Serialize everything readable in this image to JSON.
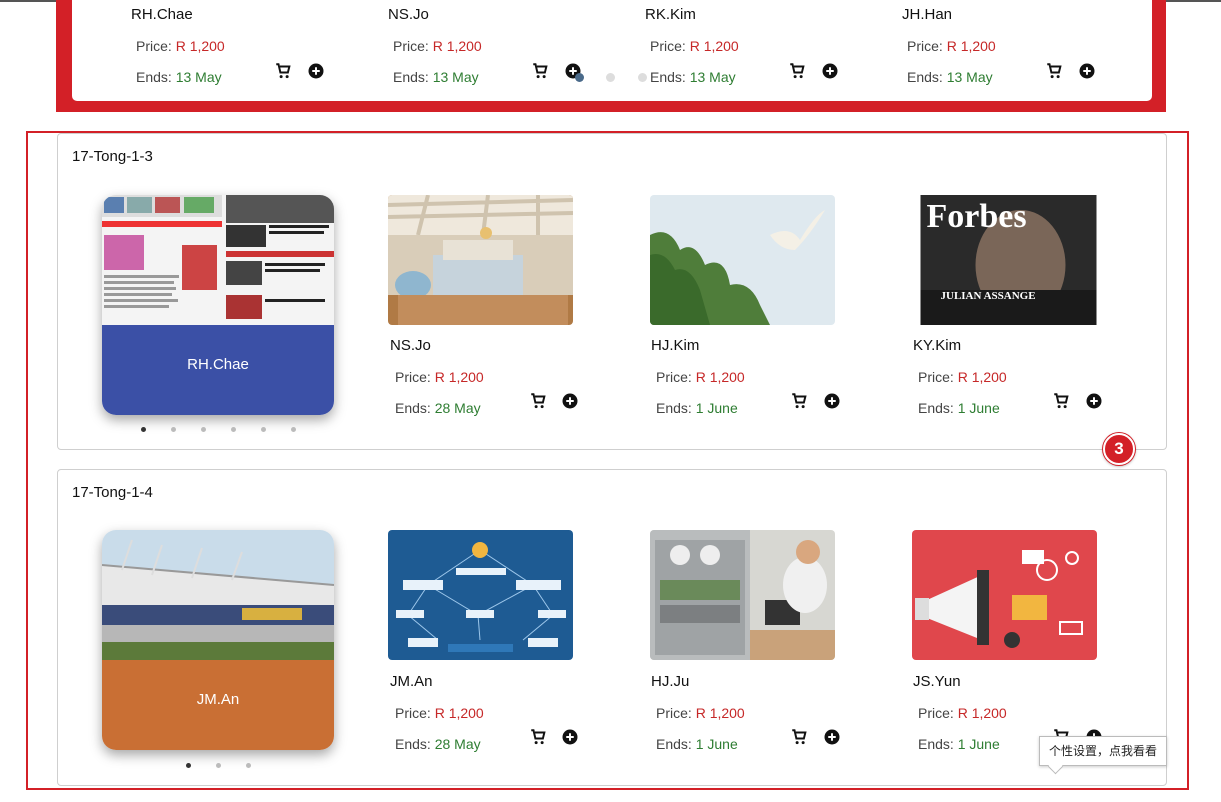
{
  "labels": {
    "price": "Price:",
    "ends": "Ends:"
  },
  "top_row": [
    {
      "seller": "RH.Chae",
      "price": "R 1,200",
      "ends": "13 May"
    },
    {
      "seller": "NS.Jo",
      "price": "R 1,200",
      "ends": "13 May"
    },
    {
      "seller": "RK.Kim",
      "price": "R 1,200",
      "ends": "13 May"
    },
    {
      "seller": "JH.Han",
      "price": "R 1,200",
      "ends": "13 May"
    }
  ],
  "annotation_badge": "3",
  "sections": [
    {
      "title": "17-Tong-1-3",
      "hero": {
        "seller": "RH.Chae",
        "band_color": "#3b50a6"
      },
      "items": [
        {
          "seller": "NS.Jo",
          "price": "R 1,200",
          "ends": "28 May"
        },
        {
          "seller": "HJ.Kim",
          "price": "R 1,200",
          "ends": "1 June"
        },
        {
          "seller": "KY.Kim",
          "price": "R 1,200",
          "ends": "1 June"
        }
      ]
    },
    {
      "title": "17-Tong-1-4",
      "hero": {
        "seller": "JM.An",
        "band_color": "#c96f34"
      },
      "items": [
        {
          "seller": "JM.An",
          "price": "R 1,200",
          "ends": "28 May"
        },
        {
          "seller": "HJ.Ju",
          "price": "R 1,200",
          "ends": "1 June"
        },
        {
          "seller": "JS.Yun",
          "price": "R 1,200",
          "ends": "1 June"
        }
      ]
    }
  ],
  "magazine": {
    "masthead": "Forbes",
    "cover_name": "JULIAN ASSANGE"
  },
  "tooltip": "个性设置，点我看看",
  "colors": {
    "price": "#c62828",
    "ends": "#2e7d32",
    "annotation": "#d32027"
  }
}
